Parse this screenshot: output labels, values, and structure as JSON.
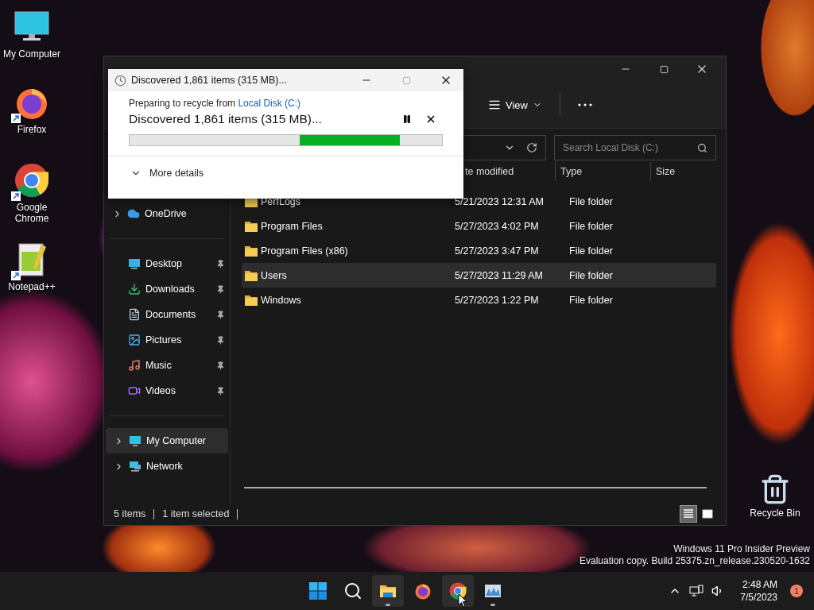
{
  "desktop_icons": [
    {
      "kind": "computer",
      "label": "My Computer",
      "shortcut": false
    },
    {
      "kind": "firefox",
      "label": "Firefox",
      "shortcut": true
    },
    {
      "kind": "chrome",
      "label": "Google Chrome",
      "shortcut": true
    },
    {
      "kind": "notepad",
      "label": "Notepad++",
      "shortcut": true
    }
  ],
  "recycle_bin": {
    "label": "Recycle Bin"
  },
  "explorer": {
    "toolbar": {
      "view": "View"
    },
    "search": {
      "placeholder": "Search Local Disk (C:)"
    },
    "columns": [
      "te modified",
      "Type",
      "Size"
    ],
    "sidebar": [
      [
        {
          "kind": "cloud",
          "label": "OneDrive",
          "expandable": true,
          "pinned": false,
          "selected": false
        }
      ],
      [
        {
          "kind": "desktop",
          "label": "Desktop",
          "expandable": false,
          "pinned": true,
          "selected": false
        },
        {
          "kind": "downloads",
          "label": "Downloads",
          "expandable": false,
          "pinned": true,
          "selected": false
        },
        {
          "kind": "documents",
          "label": "Documents",
          "expandable": false,
          "pinned": true,
          "selected": false
        },
        {
          "kind": "pictures",
          "label": "Pictures",
          "expandable": false,
          "pinned": true,
          "selected": false
        },
        {
          "kind": "music",
          "label": "Music",
          "expandable": false,
          "pinned": true,
          "selected": false
        },
        {
          "kind": "videos",
          "label": "Videos",
          "expandable": false,
          "pinned": true,
          "selected": false
        }
      ],
      [
        {
          "kind": "computer",
          "label": "My Computer",
          "expandable": true,
          "pinned": false,
          "selected": true
        },
        {
          "kind": "network",
          "label": "Network",
          "expandable": true,
          "pinned": false,
          "selected": false
        }
      ]
    ],
    "rows": [
      {
        "name": "PerfLogs",
        "date": "5/21/2023 12:31 AM",
        "type": "File folder",
        "selected": false
      },
      {
        "name": "Program Files",
        "date": "5/27/2023 4:02 PM",
        "type": "File folder",
        "selected": false
      },
      {
        "name": "Program Files (x86)",
        "date": "5/27/2023 3:47 PM",
        "type": "File folder",
        "selected": false
      },
      {
        "name": "Users",
        "date": "5/27/2023 11:29 AM",
        "type": "File folder",
        "selected": true
      },
      {
        "name": "Windows",
        "date": "5/27/2023 1:22 PM",
        "type": "File folder",
        "selected": false
      }
    ],
    "status": {
      "count": "5 items",
      "selection": "1 item selected"
    },
    "view_modes": [
      {
        "kind": "details",
        "selected": true
      },
      {
        "kind": "tiles",
        "selected": false
      }
    ]
  },
  "dialog": {
    "title": "Discovered 1,861 items (315 MB)...",
    "maximize_disabled": true,
    "source_prefix": "Preparing to recycle from",
    "source_link": "Local Disk (C:)",
    "status": "Discovered 1,861 items (315 MB)...",
    "progress": {
      "indeterminate": true
    },
    "more": "More details"
  },
  "edition_notice": [
    "Windows 11 Pro Insider Preview",
    "Evaluation copy. Build 25375.zn_release.230520-1632"
  ],
  "taskbar": {
    "apps": [
      {
        "kind": "start",
        "highlighted": false,
        "running": false
      },
      {
        "kind": "search",
        "highlighted": false,
        "running": false
      },
      {
        "kind": "explorer",
        "highlighted": true,
        "running": true
      },
      {
        "kind": "firefox",
        "highlighted": false,
        "running": false
      },
      {
        "kind": "chrome",
        "highlighted": true,
        "running": false
      },
      {
        "kind": "monitor",
        "highlighted": false,
        "running": true
      }
    ],
    "time": "2:48 AM",
    "date": "7/5/2023",
    "notifications": "1"
  }
}
